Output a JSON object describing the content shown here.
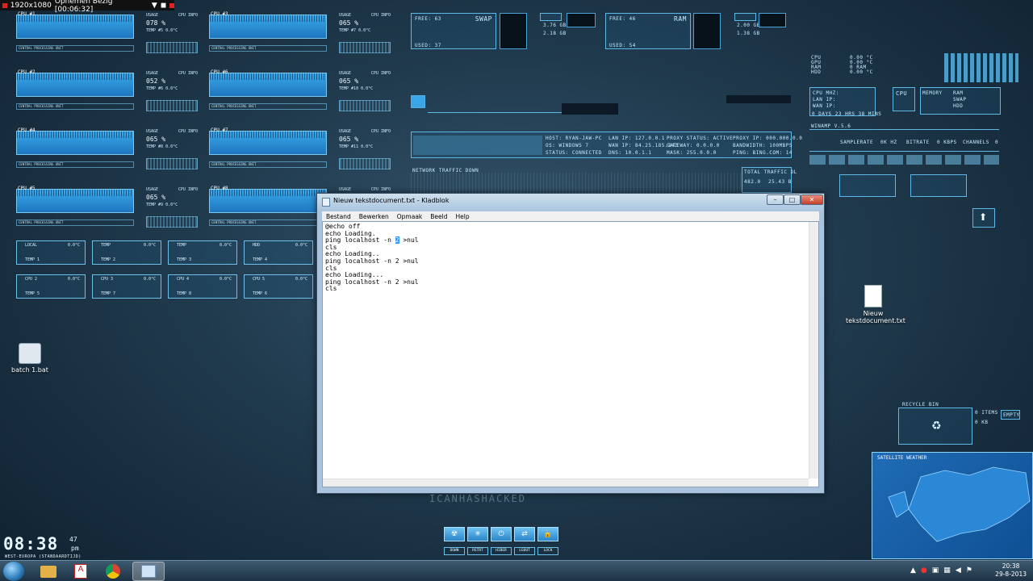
{
  "recorder": {
    "resolution": "1920x1080",
    "status": "Opnemen Bezig [00:06:32]"
  },
  "cpu_panels": [
    {
      "name": "CPU #1",
      "usage": "078 %",
      "temp": "TEMP #5",
      "tempval": "0.0°C",
      "footer": "CENTRAL PROCESSING UNIT"
    },
    {
      "name": "CPU #3",
      "usage": "065 %",
      "temp": "TEMP #7",
      "tempval": "0.0°C",
      "footer": "CENTRAL PROCESSING UNIT"
    },
    {
      "name": "CPU #2",
      "usage": "052 %",
      "temp": "TEMP #6",
      "tempval": "0.0°C",
      "footer": "CENTRAL PROCESSING UNIT"
    },
    {
      "name": "CPU #6",
      "usage": "065 %",
      "temp": "TEMP #10",
      "tempval": "0.0°C",
      "footer": "CENTRAL PROCESSING UNIT"
    },
    {
      "name": "CPU #4",
      "usage": "065 %",
      "temp": "TEMP #8",
      "tempval": "0.0°C",
      "footer": "CENTRAL PROCESSING UNIT"
    },
    {
      "name": "CPU #7",
      "usage": "065 %",
      "temp": "TEMP #11",
      "tempval": "0.0°C",
      "footer": "CENTRAL PROCESSING UNIT"
    },
    {
      "name": "CPU #5",
      "usage": "065 %",
      "temp": "TEMP #9",
      "tempval": "0.0°C",
      "footer": "CENTRAL PROCESSING UNIT"
    },
    {
      "name": "CPU #8",
      "usage": "065 %",
      "temp": "TEMP #12",
      "tempval": "0.0°C",
      "footer": "CENTRAL PROCESSING UNIT"
    }
  ],
  "usage_head": {
    "left": "USAGE",
    "right": "CPU INFO"
  },
  "temp_boxes": [
    {
      "top": "LOCAL",
      "val": "0.0°C",
      "bottom": "TEMP 1"
    },
    {
      "top": "TEMP",
      "val": "0.0°C",
      "bottom": "TEMP 2"
    },
    {
      "top": "TEMP",
      "val": "0.0°C",
      "bottom": "TEMP 3"
    },
    {
      "top": "HDD",
      "val": "0.0°C",
      "bottom": "TEMP 4"
    },
    {
      "top": "CPU 2",
      "val": "0.0°C",
      "bottom": "TEMP 5"
    },
    {
      "top": "CPU 3",
      "val": "0.0°C",
      "bottom": "TEMP 7"
    },
    {
      "top": "CPU 4",
      "val": "0.0°C",
      "bottom": "TEMP 8"
    },
    {
      "top": "CPU 5",
      "val": "0.0°C",
      "bottom": "TEMP 6"
    }
  ],
  "swap": {
    "label": "SWAP",
    "free": "FREE: 63",
    "used": "USED: 37",
    "v1": "3.76 GB",
    "v2": "2.18 GB"
  },
  "ram": {
    "label": "RAM",
    "free": "FREE: 46",
    "used": "USED: 54",
    "v1": "2.00 GB",
    "v2": "1.38 GB"
  },
  "network": {
    "host": "HOST: RYAN-JAW-PC",
    "os": "OS: WINDOWS 7",
    "status": "STATUS: CONNECTED",
    "lan": "LAN IP: 127.0.0.1",
    "wan": "WAN IP: 84.25.185.143",
    "dns": "DNS: 10.0.1.1",
    "proxy": "PROXY STATUS: ACTIVE",
    "gateway": "GATEWAY: 0.0.0.0",
    "mask": "MASK: 255.0.0.0",
    "proxy_ip": "PROXY IP: 000.000.0.0",
    "bandwidth": "BANDWIDTH: 100MBPS",
    "ping": "PING: BING.COM: 14",
    "traffic_down": "NETWORK TRAFFIC DOWN",
    "total_traffic": "TOTAL TRAFFIC DL",
    "total_a": "482.0",
    "total_b": "25.43 B"
  },
  "sysmon": {
    "cpu": "CPU",
    "gpu": "GPU",
    "ram": "RAM",
    "hdd": "HDD",
    "cpu_t": "0.00 °C",
    "gpu_t": "0.00 °C",
    "ram_t": "0 RAM",
    "hdd_t": "0.00 °C",
    "uptime": "0 DAYS 23 HRS 38 MINS",
    "cpu_mhz": "CPU MHZ:",
    "lan_ip": "LAN IP:",
    "wan_ip": "WAN IP:",
    "mem": "MEMORY",
    "ram2": "RAM",
    "swap2": "SWAP",
    "hdd2": "HDD"
  },
  "winamp": {
    "title": "WINAMP V.5.6",
    "samplerate": "SAMPLERATE",
    "khz": "0K HZ",
    "bitrate": "BITRATE",
    "kbps": "0 KBPS",
    "channels": "CHANNELS",
    "ch": "0"
  },
  "recycle": {
    "label": "RECYCLE BIN",
    "items": "0 ITEMS",
    "size": "0 KB",
    "empty": "EMPTY"
  },
  "weather": {
    "title": "SATELLITE WEATHER"
  },
  "desktop_icons": {
    "batch": "batch 1.bat",
    "txt_line1": "Nieuw",
    "txt_line2": "tekstdocument.txt"
  },
  "notepad": {
    "title": "Nieuw tekstdocument.txt - Kladblok",
    "menu": [
      "Bestand",
      "Bewerken",
      "Opmaak",
      "Beeld",
      "Help"
    ],
    "lines": [
      "@echo off",
      "echo Loading.",
      "ping localhost -n ",
      "cls",
      "echo Loading..",
      "ping localhost -n 2 >nul",
      "cls",
      "echo Loading...",
      "ping localhost -n 2 >nul",
      "cls"
    ],
    "sel_char": "2",
    "line3_tail": " >nul"
  },
  "watermark": "ICANHASHACKED",
  "dock": [
    "DOWN",
    "RSTRT",
    "HIBER",
    "LGOUT",
    "LOCK"
  ],
  "clock": {
    "time": "08:38",
    "sec": "47",
    "ampm": "pm",
    "zone": "WEST-EUROPA (STANDAARDTIJD)"
  },
  "taskbar": {
    "time": "20:38",
    "date": "29-8-2013"
  }
}
